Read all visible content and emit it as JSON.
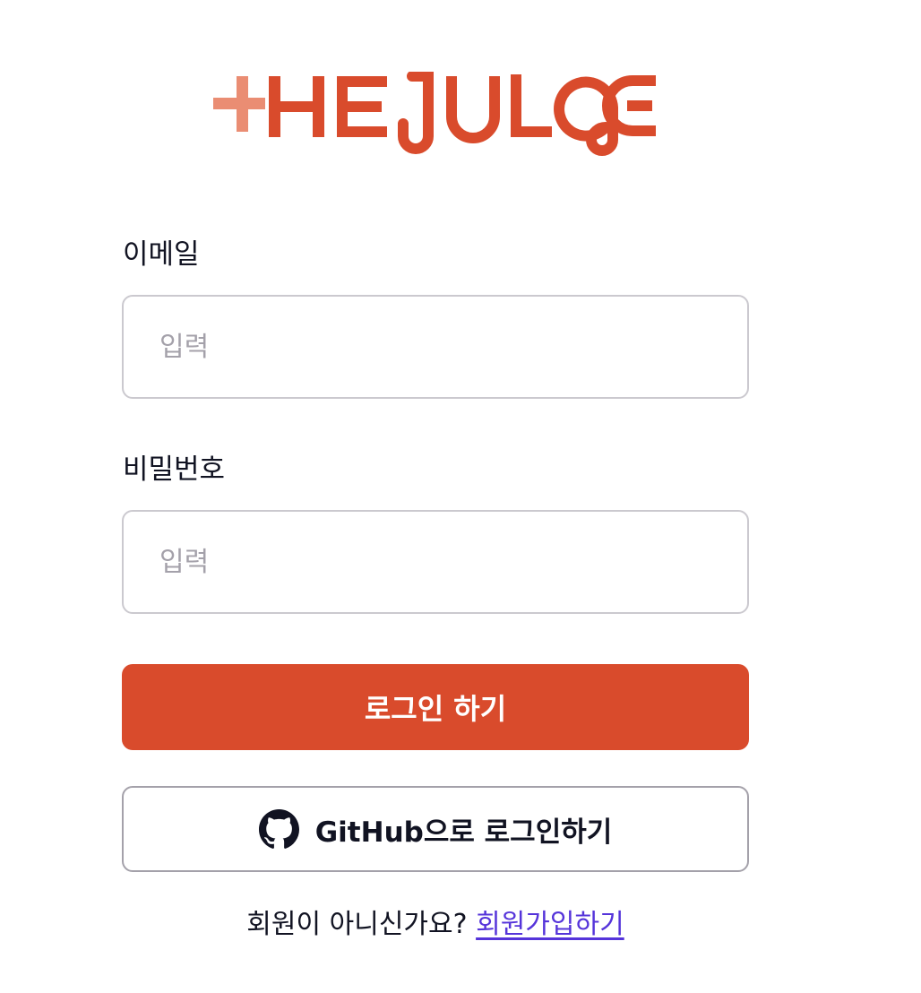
{
  "logo": {
    "text": "+HE JULGE",
    "colors": {
      "plus": "#ea8d73",
      "letters": "#d94b2c"
    }
  },
  "form": {
    "email": {
      "label": "이메일",
      "placeholder": "입력",
      "value": ""
    },
    "password": {
      "label": "비밀번호",
      "placeholder": "입력",
      "value": ""
    },
    "login_button": "로그인 하기",
    "github_button": {
      "icon": "github-icon",
      "label": "GitHub으로 로그인하기"
    }
  },
  "signup": {
    "prompt": "회원이 아니신가요?",
    "link": "회원가입하기"
  },
  "colors": {
    "primary": "#d94b2c",
    "link": "#5534da",
    "input_border": "#cbc9cf",
    "placeholder": "#a4a1aa"
  }
}
